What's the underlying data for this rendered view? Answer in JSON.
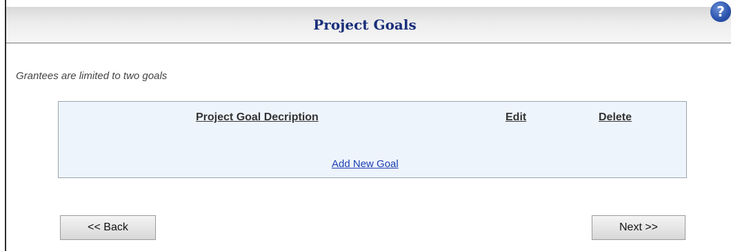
{
  "header": {
    "title": "Project Goals",
    "help_icon_glyph": "?",
    "help_icon_name": "help-icon"
  },
  "note": "Grantees are limited to two goals",
  "table": {
    "columns": [
      "Project Goal Decription",
      "Edit",
      "Delete"
    ],
    "add_link": "Add New Goal",
    "background": "#eef4fc"
  },
  "buttons": {
    "back": "<< Back",
    "next": "Next >>"
  },
  "colors": {
    "title": "#1a2f7a",
    "link": "#1a3fb0",
    "help_icon": "#2e56b0"
  }
}
